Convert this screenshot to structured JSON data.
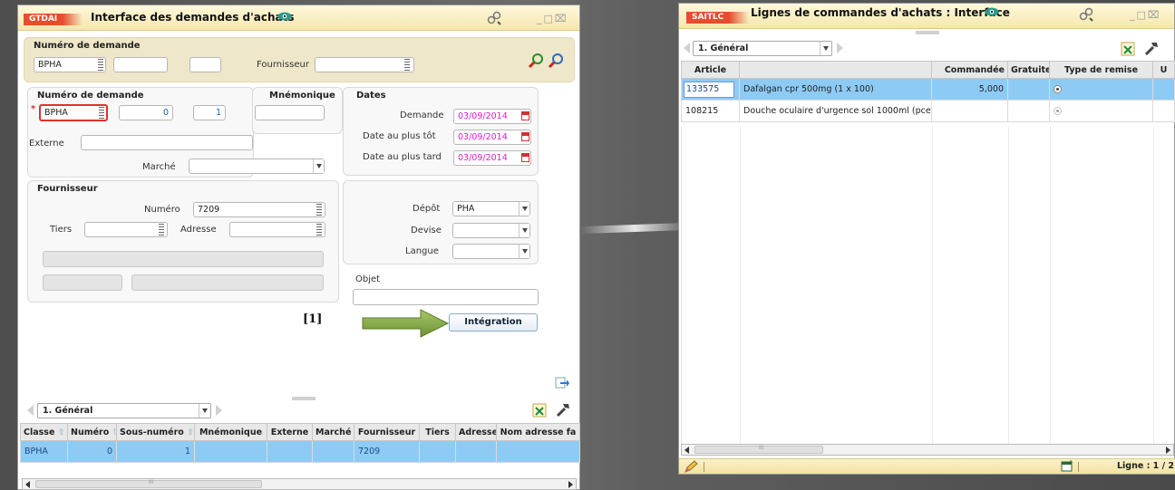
{
  "left_window": {
    "code": "GTDAI",
    "title": "Interface des demandes d'achats",
    "header_filter": {
      "label": "Numéro de demande",
      "class_value": "BPHA",
      "number_value": "",
      "sub_value": "",
      "supplier_label": "Fournisseur",
      "supplier_value": ""
    },
    "request": {
      "numero_label": "Numéro de demande",
      "class_value": "BPHA",
      "number_value": "0",
      "sub_value": "1",
      "mnemo_label": "Mnémonique",
      "mnemo_value": "",
      "externe_label": "Externe",
      "externe_value": "",
      "marche_label": "Marché",
      "marche_value": ""
    },
    "dates": {
      "label": "Dates",
      "demande_label": "Demande",
      "demande_value": "03/09/2014",
      "tot_label": "Date au plus tôt",
      "tot_value": "03/09/2014",
      "tard_label": "Date au plus tard",
      "tard_value": "03/09/2014"
    },
    "supplier": {
      "label": "Fournisseur",
      "numero_label": "Numéro",
      "numero_value": "7209",
      "tiers_label": "Tiers",
      "tiers_value": "",
      "adresse_label": "Adresse",
      "adresse_value": ""
    },
    "logistics": {
      "depot_label": "Dépôt",
      "depot_value": "PHA",
      "devise_label": "Devise",
      "devise_value": "",
      "langue_label": "Langue",
      "langue_value": "",
      "objet_label": "Objet",
      "objet_value": ""
    },
    "annotation": "[1]",
    "integration_button": "Intégration",
    "tab_selector": "1. Général",
    "grid": {
      "columns": [
        "Classe",
        "Numéro",
        "Sous-numéro",
        "Mnémonique",
        "Externe",
        "Marché",
        "Fournisseur",
        "Tiers",
        "Adresse",
        "Nom adresse fa"
      ],
      "rows": [
        [
          "BPHA",
          "0",
          "1",
          "",
          "",
          "",
          "7209",
          "",
          "",
          ""
        ]
      ]
    }
  },
  "right_window": {
    "code": "SAITLC",
    "title": "Lignes de commandes d'achats : Interface",
    "tab_selector": "1. Général",
    "grid": {
      "columns": [
        "Article",
        "",
        "Commandée",
        "Gratuite",
        "Type de remise",
        "U"
      ],
      "rows": [
        [
          "133575",
          "Dafalgan cpr 500mg (1 x 100)",
          "5,000",
          "",
          "radio",
          ""
        ],
        [
          "108215",
          "Douche oculaire d'urgence sol 1000ml (pce",
          "",
          "",
          "radio",
          ""
        ]
      ]
    },
    "status_text": "Ligne : 1 / 2"
  },
  "colors": {
    "tag": "#e54d2e",
    "title_bar": "#f4e7ad",
    "selected_row": "#8ecbf4",
    "date_text": "#e01ad0",
    "arrow": "#8db04a"
  }
}
